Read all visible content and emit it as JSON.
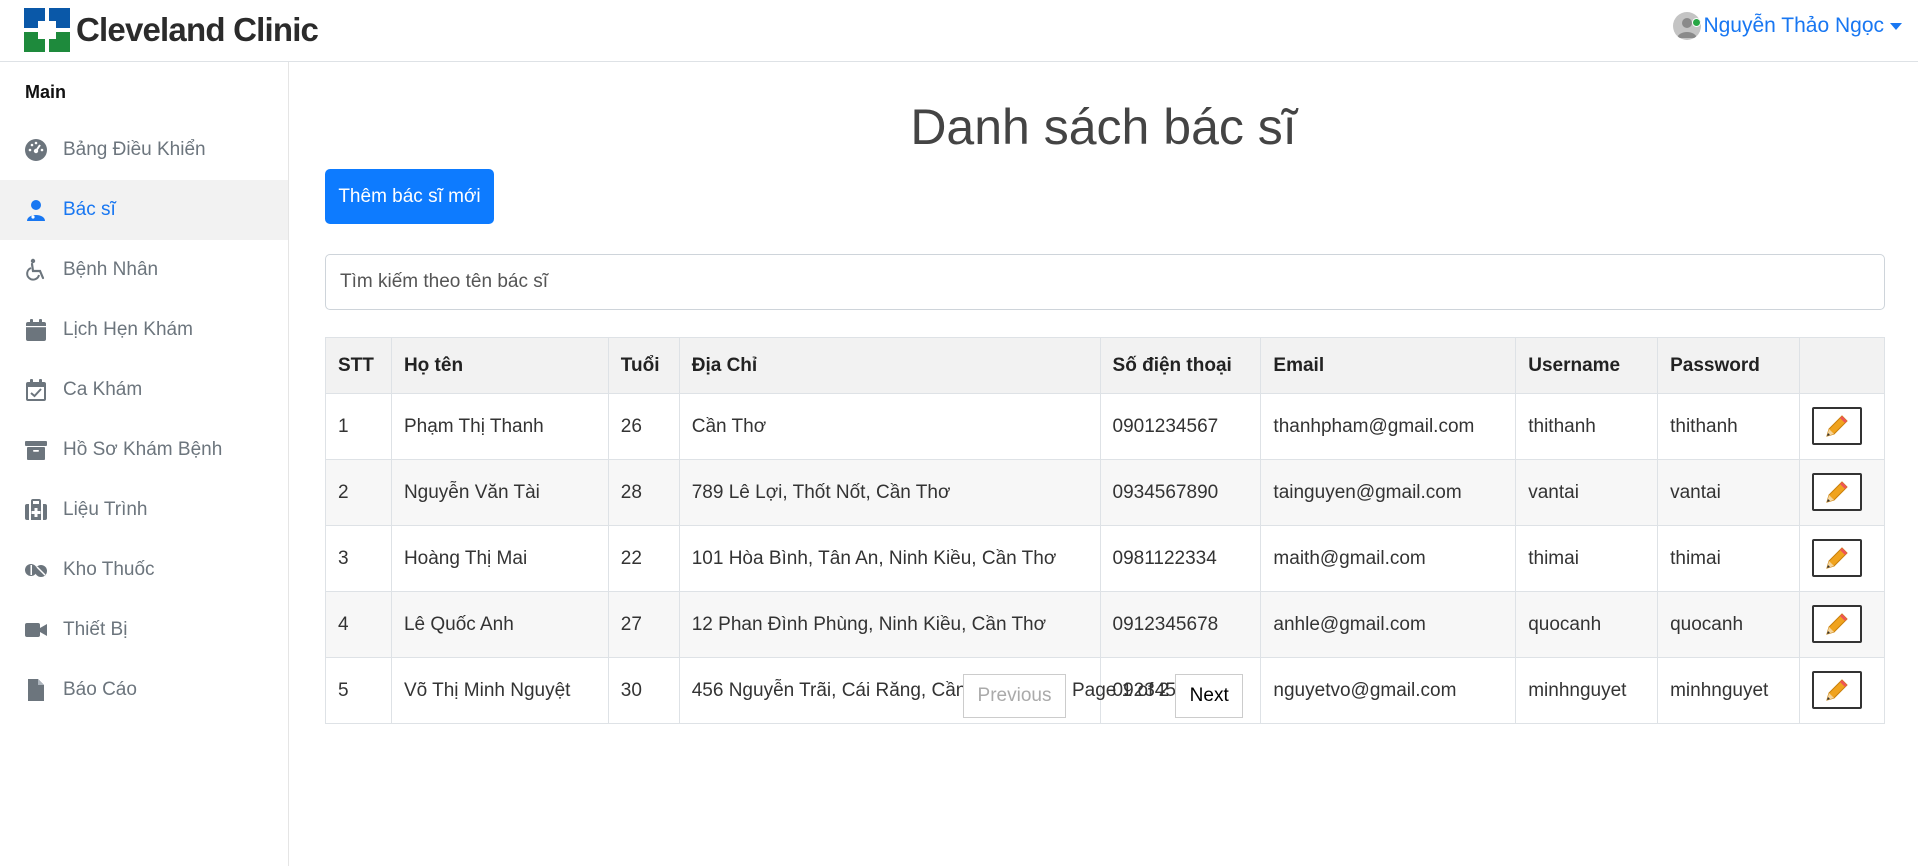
{
  "brand": {
    "name": "Cleveland Clinic",
    "accent": "#1877f2"
  },
  "user": {
    "name": "Nguyễn Thảo Ngọc"
  },
  "sidebar": {
    "heading": "Main",
    "items": [
      {
        "label": "Bảng Điều Khiển",
        "icon": "dashboard-icon"
      },
      {
        "label": "Bác sĩ",
        "icon": "doctor-icon",
        "active": true
      },
      {
        "label": "Bệnh Nhân",
        "icon": "wheelchair-icon"
      },
      {
        "label": "Lịch Hẹn Khám",
        "icon": "calendar-icon"
      },
      {
        "label": "Ca Khám",
        "icon": "calendar-check-icon"
      },
      {
        "label": "Hồ Sơ Khám Bệnh",
        "icon": "archive-icon"
      },
      {
        "label": "Liệu Trình",
        "icon": "medical-bag-icon"
      },
      {
        "label": "Kho Thuốc",
        "icon": "pills-icon"
      },
      {
        "label": "Thiết Bị",
        "icon": "video-icon"
      },
      {
        "label": "Báo Cáo",
        "icon": "file-icon"
      }
    ]
  },
  "main": {
    "title": "Danh sách bác sĩ",
    "add_button": "Thêm bác sĩ mới",
    "search_placeholder": "Tìm kiếm theo tên bác sĩ",
    "table": {
      "headers": [
        "STT",
        "Họ tên",
        "Tuổi",
        "Địa Chỉ",
        "Số điện thoại",
        "Email",
        "Username",
        "Password",
        ""
      ],
      "rows": [
        [
          "1",
          "Phạm Thị Thanh",
          "26",
          "Cần Thơ",
          "0901234567",
          "thanhpham@gmail.com",
          "thithanh",
          "thithanh"
        ],
        [
          "2",
          "Nguyễn Văn Tài",
          "28",
          "789 Lê Lợi, Thốt Nốt, Cần Thơ",
          "0934567890",
          "tainguyen@gmail.com",
          "vantai",
          "vantai"
        ],
        [
          "3",
          "Hoàng Thị Mai",
          "22",
          "101 Hòa Bình, Tân An, Ninh Kiều, Cần Thơ",
          "0981122334",
          "maith@gmail.com",
          "thimai",
          "thimai"
        ],
        [
          "4",
          "Lê Quốc Anh",
          "27",
          "12 Phan Đình Phùng, Ninh Kiều, Cần Thơ",
          "0912345678",
          "anhle@gmail.com",
          "quocanh",
          "quocanh"
        ],
        [
          "5",
          "Võ Thị Minh Nguyệt",
          "30",
          "456 Nguyễn Trãi, Cái Răng, Cần Thơ",
          "0923456789",
          "nguyetvo@gmail.com",
          "minhnguyet",
          "minhnguyet"
        ]
      ],
      "edit_icon": "pencil-icon"
    },
    "pagination": {
      "previous": "Previous",
      "label": "Page 1 of 2",
      "next": "Next"
    }
  }
}
